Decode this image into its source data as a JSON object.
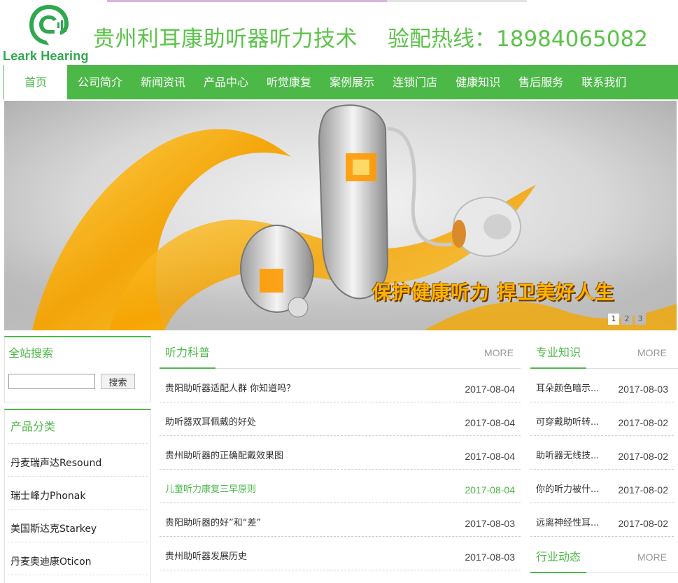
{
  "header": {
    "logo_text": "Leark Hearing",
    "site_title": "贵州利耳康助听器听力技术",
    "hotline": "验配热线：18984065082"
  },
  "nav": {
    "items": [
      "首页",
      "公司简介",
      "新闻资讯",
      "产品中心",
      "听觉康复",
      "案例展示",
      "连锁门店",
      "健康知识",
      "售后服务",
      "联系我们"
    ]
  },
  "banner": {
    "slogan": "保护健康听力 捍卫美好人生",
    "dots": [
      "1",
      "2",
      "3"
    ],
    "active_dot": 0
  },
  "search": {
    "title": "全站搜索",
    "button": "搜索",
    "value": ""
  },
  "categories": {
    "title": "产品分类",
    "items": [
      "丹麦瑞声达Resound",
      "瑞士峰力Phonak",
      "美国斯达克Starkey",
      "丹麦奥迪康Oticon"
    ]
  },
  "science": {
    "title": "听力科普",
    "more": "MORE",
    "items": [
      {
        "title": "贵阳助听器适配人群 你知道吗？",
        "date": "2017-08-04"
      },
      {
        "title": "助听器双耳佩戴的好处",
        "date": "2017-08-04"
      },
      {
        "title": "贵州助听器的正确配戴效果图",
        "date": "2017-08-04"
      },
      {
        "title": "儿童听力康复三早原则",
        "date": "2017-08-04"
      },
      {
        "title": "贵阳助听器的好”和“差”",
        "date": "2017-08-03"
      },
      {
        "title": "贵州助听器发展历史",
        "date": "2017-08-03"
      }
    ]
  },
  "knowledge": {
    "title": "专业知识",
    "more": "MORE",
    "items": [
      {
        "title": "耳朵颜色暗示...",
        "date": "2017-08-03"
      },
      {
        "title": "可穿戴助听转...",
        "date": "2017-08-02"
      },
      {
        "title": "助听器无线技...",
        "date": "2017-08-02"
      },
      {
        "title": "你的听力被什...",
        "date": "2017-08-02"
      },
      {
        "title": "远离神经性耳...",
        "date": "2017-08-02"
      }
    ]
  },
  "industry": {
    "title": "行业动态",
    "more": "MORE"
  },
  "colors": {
    "brand_green": "#4cb848",
    "title_green": "#5cc34a",
    "slogan_orange": "#ffb300"
  }
}
